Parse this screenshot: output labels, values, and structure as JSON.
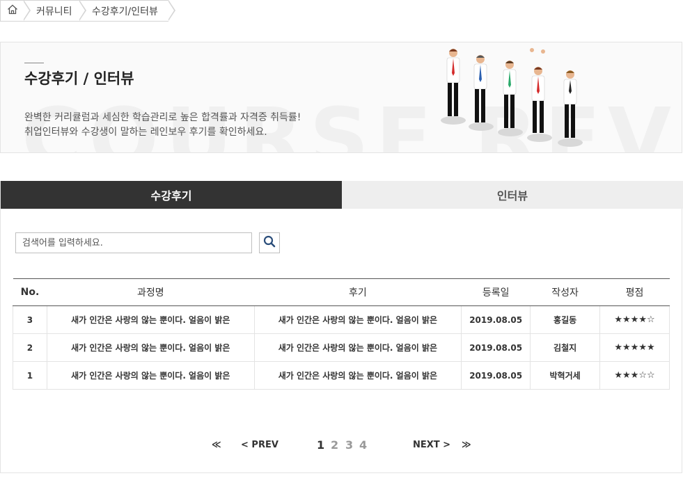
{
  "breadcrumb": {
    "home_icon": "home-icon",
    "items": [
      "커뮤니티",
      "수강후기/인터뷰"
    ]
  },
  "banner": {
    "title": "수강후기 / 인터뷰",
    "desc_line1": "완벽한 커리큘럼과 세심한 학습관리로 높은 합격률과 자격증 취득률!",
    "desc_line2": "취업인터뷰와 수강생이 말하는 레인보우 후기를 확인하세요.",
    "background_text": "COURSE REVIEW"
  },
  "tabs": [
    {
      "label": "수강후기",
      "active": true
    },
    {
      "label": "인터뷰",
      "active": false
    }
  ],
  "search": {
    "placeholder": "검색어를 입력하세요.",
    "button_icon": "search-icon"
  },
  "table": {
    "headers": [
      "No.",
      "과정명",
      "후기",
      "등록일",
      "작성자",
      "평점"
    ],
    "rows": [
      {
        "no": "3",
        "course": "새가 인간은 사랑의 않는 뿐이다. 얼음이 밝은",
        "review": "새가 인간은 사랑의 않는 뿐이다. 얼음이 밝은",
        "date": "2019.08.05",
        "author": "홍길동",
        "rating": "★★★★☆"
      },
      {
        "no": "2",
        "course": "새가 인간은 사랑의 않는 뿐이다. 얼음이 밝은",
        "review": "새가 인간은 사랑의 않는 뿐이다. 얼음이 밝은",
        "date": "2019.08.05",
        "author": "김철지",
        "rating": "★★★★★"
      },
      {
        "no": "1",
        "course": "새가 인간은 사랑의 않는 뿐이다. 얼음이 밝은",
        "review": "새가 인간은 사랑의 않는 뿐이다. 얼음이 밝은",
        "date": "2019.08.05",
        "author": "박혁거세",
        "rating": "★★★☆☆"
      }
    ]
  },
  "pagination": {
    "first": "≪",
    "prev": "< PREV",
    "pages": [
      "1",
      "2",
      "3",
      "4"
    ],
    "current": "1",
    "next": "NEXT >",
    "last": "≫"
  },
  "colors": {
    "tab_active_bg": "#333333",
    "tab_inactive_bg": "#eeeeee",
    "search_icon": "#2a4d7a"
  }
}
